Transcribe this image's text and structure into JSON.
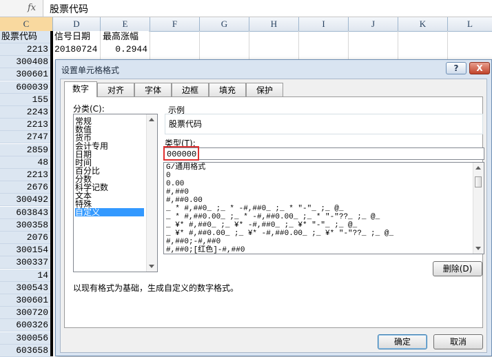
{
  "formula_bar": {
    "fx_symbol": "fx",
    "content": "股票代码"
  },
  "columns": [
    "C",
    "D",
    "E",
    "F",
    "G",
    "H",
    "I",
    "J",
    "K",
    "L"
  ],
  "sheet": {
    "header_row": {
      "c": "股票代码",
      "d": "信号日期",
      "e": "最高涨幅"
    },
    "first_row": {
      "d": "20180724",
      "e": "0.2944"
    },
    "column_c_values": [
      "2213",
      "300408",
      "300601",
      "600039",
      "155",
      "2243",
      "2213",
      "2747",
      "2859",
      "48",
      "2213",
      "2676",
      "300492",
      "603843",
      "300358",
      "2076",
      "300154",
      "300337",
      "14",
      "300543",
      "300601",
      "300720",
      "600326",
      "300056",
      "603658"
    ]
  },
  "dialog": {
    "title": "设置单元格格式",
    "help_label": "?",
    "close_label": "X",
    "tabs": [
      "数字",
      "对齐",
      "字体",
      "边框",
      "填充",
      "保护"
    ],
    "active_tab": "数字",
    "category_label": "分类(C):",
    "categories": [
      "常规",
      "数值",
      "货币",
      "会计专用",
      "日期",
      "时间",
      "百分比",
      "分数",
      "科学记数",
      "文本",
      "特殊",
      "自定义"
    ],
    "selected_category": "自定义",
    "sample_label": "示例",
    "sample_value": "股票代码",
    "type_label": "类型(T):",
    "type_value": "000000",
    "format_codes": [
      "G/通用格式",
      "0",
      "0.00",
      "#,##0",
      "#,##0.00",
      "_ * #,##0_ ;_ * -#,##0_ ;_ * \"-\"_ ;_ @_ ",
      "_ * #,##0.00_ ;_ * -#,##0.00_ ;_ * \"-\"??_ ;_ @_ ",
      "_ ¥* #,##0_ ;_ ¥* -#,##0_ ;_ ¥* \"-\"_ ;_ @_ ",
      "_ ¥* #,##0.00_ ;_ ¥* -#,##0.00_ ;_ ¥* \"-\"??_ ;_ @_ ",
      "#,##0;-#,##0",
      "#,##0;[红色]-#,##0"
    ],
    "delete_button": "删除(D)",
    "description": "以现有格式为基础，生成自定义的数字格式。",
    "ok_button": "确定",
    "cancel_button": "取消"
  },
  "colors": {
    "selection": "#3399ff",
    "highlight_border": "#e03030",
    "dialog_frame": "#d9e4f1",
    "column_selected": "#dce6f1"
  }
}
